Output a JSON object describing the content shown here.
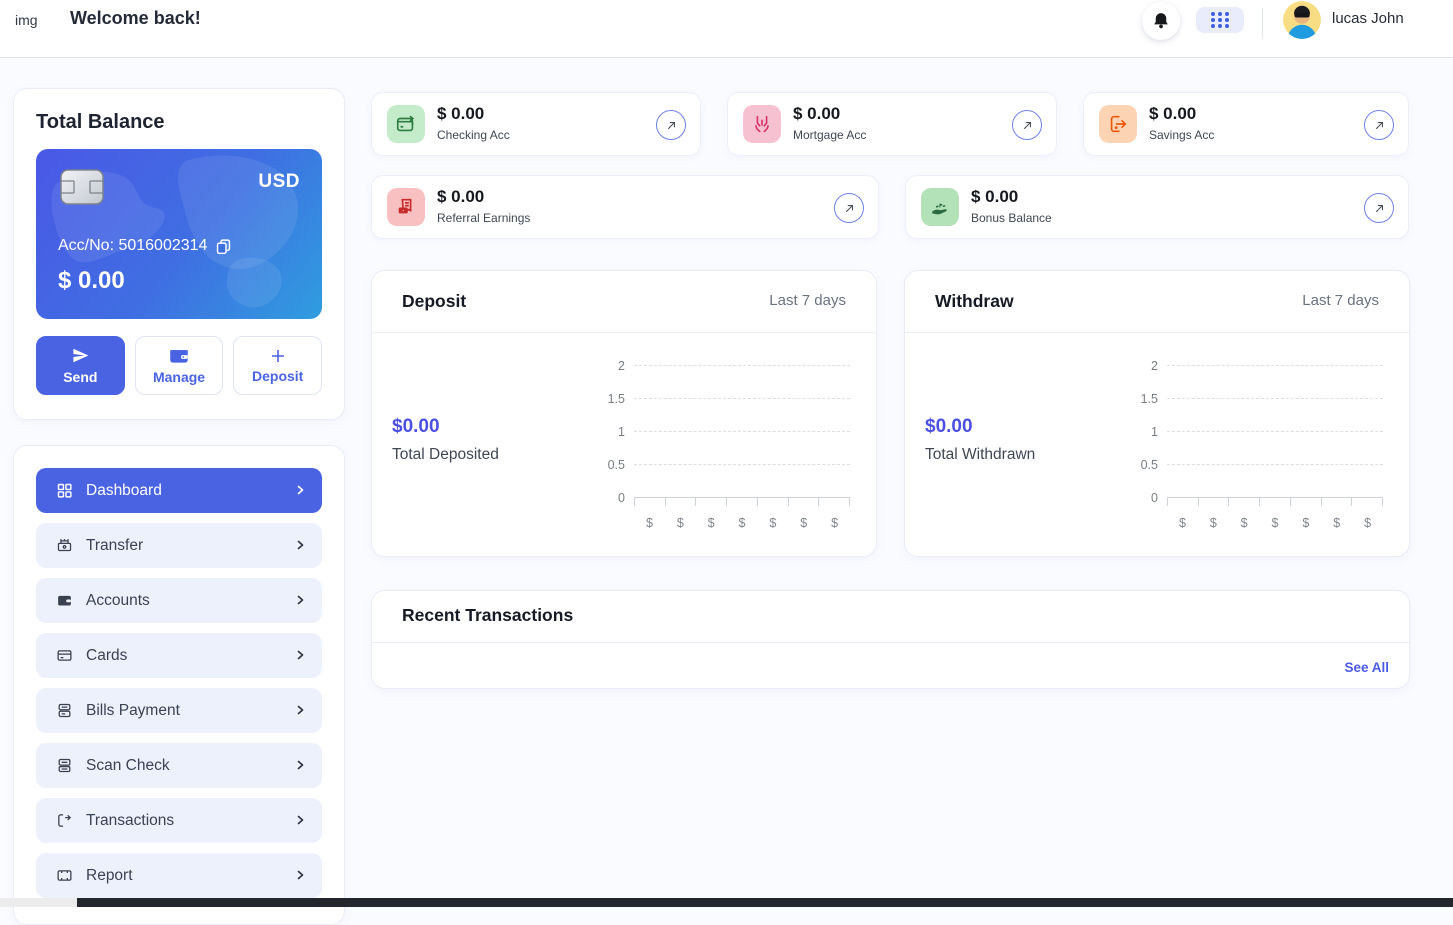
{
  "header": {
    "logo_text": "img",
    "title": "Welcome back!",
    "user_name": "lucas John"
  },
  "balance": {
    "title": "Total Balance",
    "currency": "USD",
    "account_number": "Acc/No: 5016002314",
    "amount": "$ 0.00",
    "send_label": "Send",
    "manage_label": "Manage",
    "deposit_label": "Deposit"
  },
  "menu": {
    "items": [
      {
        "label": "Dashboard",
        "active": true
      },
      {
        "label": "Transfer",
        "active": false
      },
      {
        "label": "Accounts",
        "active": false
      },
      {
        "label": "Cards",
        "active": false
      },
      {
        "label": "Bills Payment",
        "active": false
      },
      {
        "label": "Scan Check",
        "active": false
      },
      {
        "label": "Transactions",
        "active": false
      },
      {
        "label": "Report",
        "active": false
      }
    ]
  },
  "accounts": [
    {
      "amount": "$ 0.00",
      "label": "Checking Acc",
      "icon": "wallet-plus",
      "color": "green"
    },
    {
      "amount": "$ 0.00",
      "label": "Mortgage Acc",
      "icon": "hands-holding",
      "color": "pink"
    },
    {
      "amount": "$ 0.00",
      "label": "Savings Acc",
      "icon": "logout-phone",
      "color": "orange"
    },
    {
      "amount": "$ 0.00",
      "label": "Referral Earnings",
      "icon": "receipt-cash",
      "color": "red"
    },
    {
      "amount": "$ 0.00",
      "label": "Bonus Balance",
      "icon": "hand-sprout",
      "color": "green"
    }
  ],
  "charts": [
    {
      "title": "Deposit",
      "period": "Last 7 days",
      "total": "$0.00",
      "total_label": "Total Deposited",
      "y_ticks": [
        "2",
        "1.5",
        "1",
        "0.5",
        "0"
      ],
      "x_labels": [
        "$",
        "$",
        "$",
        "$",
        "$",
        "$",
        "$"
      ]
    },
    {
      "title": "Withdraw",
      "period": "Last 7 days",
      "total": "$0.00",
      "total_label": "Total Withdrawn",
      "y_ticks": [
        "2",
        "1.5",
        "1",
        "0.5",
        "0"
      ],
      "x_labels": [
        "$",
        "$",
        "$",
        "$",
        "$",
        "$",
        "$"
      ]
    }
  ],
  "chart_data": [
    {
      "type": "line",
      "title": "Deposit",
      "x": [
        "$",
        "$",
        "$",
        "$",
        "$",
        "$",
        "$"
      ],
      "values": [],
      "ylim": [
        0,
        2
      ],
      "y_ticks": [
        0,
        0.5,
        1,
        1.5,
        2
      ],
      "grid": "dashed-horizontal",
      "note": "empty chart, no data plotted"
    },
    {
      "type": "line",
      "title": "Withdraw",
      "x": [
        "$",
        "$",
        "$",
        "$",
        "$",
        "$",
        "$"
      ],
      "values": [],
      "ylim": [
        0,
        2
      ],
      "y_ticks": [
        0,
        0.5,
        1,
        1.5,
        2
      ],
      "grid": "dashed-horizontal",
      "note": "empty chart, no data plotted"
    }
  ],
  "transactions": {
    "title": "Recent Transactions",
    "see_all": "See All"
  },
  "colors": {
    "primary_blue": "#4a63e2",
    "card_gradient_start": "#4a58e6",
    "card_gradient_end": "#2f9ddf",
    "total_amount_blue": "#4b50e2",
    "see_all_blue": "#4a5ae4",
    "menu_item_bg": "#edf1fc",
    "green_icon_bg": "#c5ecca",
    "pink_icon_bg": "#f6c2d2",
    "orange_icon_bg": "#fcd4b4",
    "red_icon_bg": "#f8c0c0",
    "green2_icon_bg": "#b4e2b8"
  }
}
